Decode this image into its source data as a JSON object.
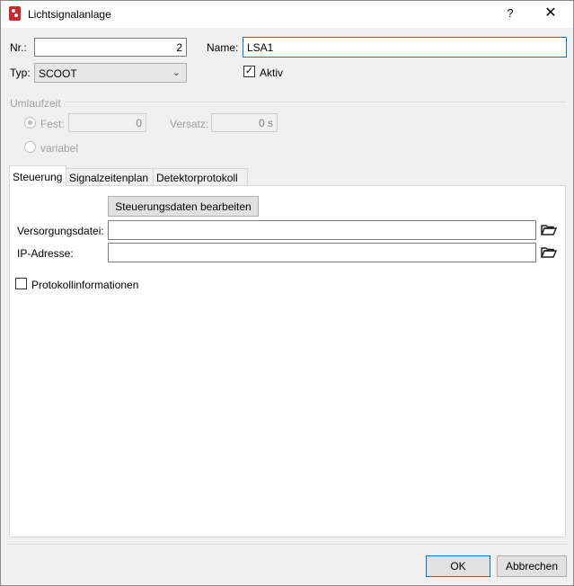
{
  "window": {
    "title": "Lichtsignalanlage",
    "help_label": "?",
    "close_glyph": "✕"
  },
  "form": {
    "nr_label": "Nr.:",
    "nr_value": "2",
    "name_label": "Name:",
    "name_value": "LSA1",
    "typ_label": "Typ:",
    "typ_value": "SCOOT",
    "aktiv_label": "Aktiv",
    "aktiv_checked": true
  },
  "umlaufzeit": {
    "group_label": "Umlaufzeit",
    "fest_label": "Fest:",
    "fest_value": "0",
    "versatz_label": "Versatz:",
    "versatz_value": "0 s",
    "variabel_label": "variabel"
  },
  "tabs": [
    {
      "label": "Steuerung",
      "active": true
    },
    {
      "label": "Signalzeitenplan",
      "active": false
    },
    {
      "label": "Detektorprotokoll",
      "active": false
    }
  ],
  "steuerung": {
    "edit_button": "Steuerungsdaten bearbeiten",
    "versorgungsdatei_label": "Versorgungsdatei:",
    "versorgungsdatei_value": "",
    "ip_label": "IP-Adresse:",
    "ip_value": "",
    "protokoll_label": "Protokollinformationen",
    "protokoll_checked": false
  },
  "footer": {
    "ok_label": "OK",
    "cancel_label": "Abbrechen"
  }
}
